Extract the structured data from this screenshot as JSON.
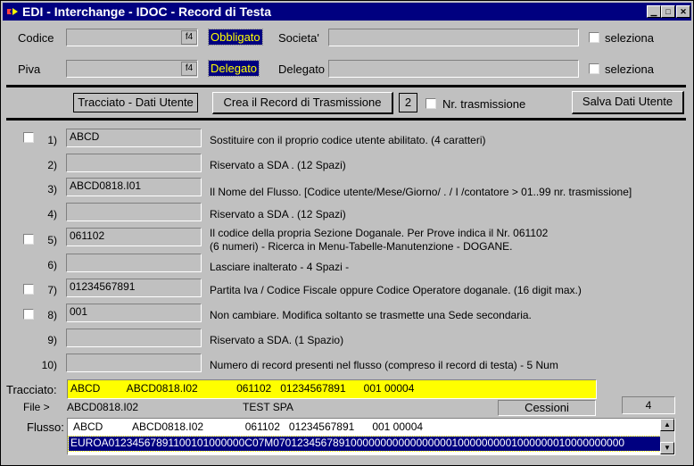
{
  "window": {
    "title": "EDI - Interchange - IDOC - Record di Testa"
  },
  "header": {
    "codice_label": "Codice",
    "piva_label": "Piva",
    "f4_label": "f4",
    "obbligato_label": "Obbligato",
    "delegato_badge": "Delegato",
    "societa_label": "Societa'",
    "delegato_label": "Delegato",
    "seleziona_label": "seleziona"
  },
  "toolbar": {
    "tracciato_btn": "Tracciato - Dati Utente",
    "crea_btn": "Crea il Record di Trasmissione",
    "nr_value": "2",
    "nr_label": "Nr. trasmissione",
    "salva_btn": "Salva Dati Utente"
  },
  "rows": [
    {
      "num": "1)",
      "value": "ABCD",
      "desc": "Sostituire con il proprio codice utente abilitato. (4 caratteri)"
    },
    {
      "num": "2)",
      "value": "",
      "desc": "Riservato a  SDA . (12 Spazi)"
    },
    {
      "num": "3)",
      "value": "ABCD0818.I01",
      "desc": "Il Nome del Flusso. [Codice utente/Mese/Giorno/ . / I /contatore > 01..99 nr. trasmissione]"
    },
    {
      "num": "4)",
      "value": "",
      "desc": "Riservato a  SDA . (12 Spazi)"
    },
    {
      "num": "5)",
      "value": "061102",
      "desc": "Il codice della propria Sezione Doganale. Per Prove indica il Nr.  061102",
      "desc2": "(6 numeri) - Ricerca in Menu-Tabelle-Manutenzione - DOGANE."
    },
    {
      "num": "6)",
      "value": "",
      "desc": "Lasciare inalterato - 4 Spazi -"
    },
    {
      "num": "7)",
      "value": "01234567891",
      "desc": "Partita Iva / Codice Fiscale oppure Codice  Operatore doganale. (16 digit max.)"
    },
    {
      "num": "8)",
      "value": "001",
      "desc": "Non cambiare.  Modifica soltanto se trasmette una Sede secondaria."
    },
    {
      "num": "9)",
      "value": "",
      "desc": "Riservato a  SDA. (1 Spazio)"
    },
    {
      "num": "10)",
      "value": "",
      "desc": "Numero di record presenti nel flusso (compreso il record di testa) - 5 Num"
    }
  ],
  "footer": {
    "tracciato_label": "Tracciato:",
    "tracciato_value": "ABCD         ABCD0818.I02             061102   01234567891      001 00004",
    "file_label": "File >",
    "file_value": "ABCD0818.I02",
    "company": "TEST SPA",
    "cessioni_label": "Cessioni",
    "count": "4",
    "flusso_label": "Flusso:",
    "flusso_line1": "ABCD          ABCD0818.I02              061102   01234567891      001 00004",
    "flusso_line2": "EUROA01234567891100101000000C07M07012345678910000000000000000010000000001000000010000000000"
  },
  "colors": {
    "titlebar": "#000080",
    "badge_text": "#ffff00",
    "tracciato_bg": "#ffff00"
  }
}
